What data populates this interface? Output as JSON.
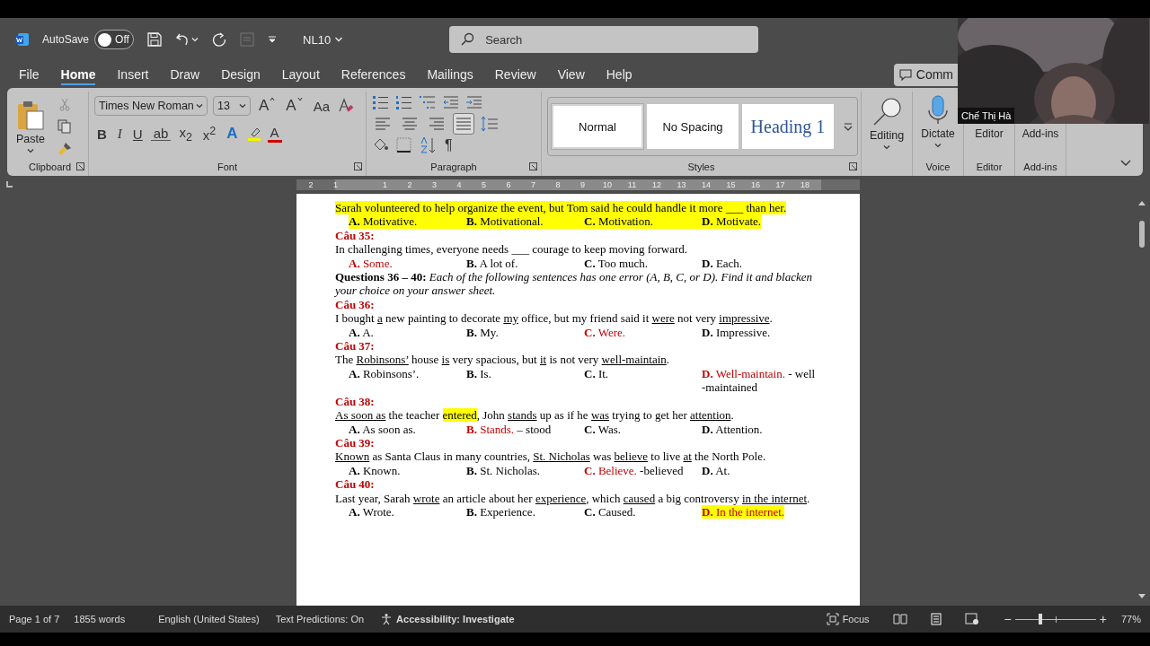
{
  "title_bar": {
    "autosave_label": "AutoSave",
    "autosave": {
      "on": false,
      "label": "Off"
    },
    "document_name": "NL10",
    "search": {
      "placeholder": "Search"
    }
  },
  "menu_tabs": [
    {
      "label": "File",
      "selected": false
    },
    {
      "label": "Home",
      "selected": true
    },
    {
      "label": "Insert",
      "selected": false
    },
    {
      "label": "Draw",
      "selected": false
    },
    {
      "label": "Design",
      "selected": false
    },
    {
      "label": "Layout",
      "selected": false
    },
    {
      "label": "References",
      "selected": false
    },
    {
      "label": "Mailings",
      "selected": false
    },
    {
      "label": "Review",
      "selected": false
    },
    {
      "label": "View",
      "selected": false
    },
    {
      "label": "Help",
      "selected": false
    }
  ],
  "comments_button": {
    "label": "Comm"
  },
  "ribbon": {
    "clipboard": {
      "paste_label": "Paste",
      "cut_disabled": true,
      "group_label": "Clipboard"
    },
    "font": {
      "font_name": "Times New Roman",
      "font_size": "13",
      "grow": "A",
      "shrink": "A",
      "change_case": "Aa",
      "format_buttons": [
        "B",
        "I",
        "U",
        "ab",
        "x$_{2}$",
        "x$^{2}$"
      ],
      "text_effects": "A",
      "font_color": "A",
      "group_label": "Font"
    },
    "paragraph": {
      "alignment": [
        {
          "kind": "left",
          "selected": false
        },
        {
          "kind": "center",
          "selected": false
        },
        {
          "kind": "right",
          "selected": false
        },
        {
          "kind": "justify",
          "selected": true
        }
      ],
      "show_marks": "¶",
      "group_label": "Paragraph"
    },
    "styles": {
      "items": [
        {
          "label": "Normal",
          "kind": "normal",
          "selected": true
        },
        {
          "label": "No Spacing",
          "kind": "normal",
          "selected": false
        },
        {
          "label": "Heading 1",
          "kind": "heading",
          "selected": false
        }
      ],
      "group_label": "Styles"
    },
    "editing": {
      "label": "Editing"
    },
    "voice": {
      "button": "Dictate",
      "group_label": "Voice"
    },
    "editor": {
      "button": "Editor",
      "group_label": "Editor"
    },
    "addins": {
      "button": "Add-ins",
      "group_label": "Add-ins"
    }
  },
  "webcam": {
    "name": "Chế Thị Hà"
  },
  "ruler": {
    "left_labels": [
      "2",
      "1"
    ],
    "right_labels": [
      "1",
      "2",
      "3",
      "4",
      "5",
      "6",
      "7",
      "8",
      "9",
      "10",
      "11",
      "12",
      "13",
      "14",
      "15",
      "16",
      "17",
      "18"
    ]
  },
  "document": [
    {
      "kind": "sentence",
      "segments": [
        {
          "text": "Sarah volunteered to help organize the event, but Tom said he could handle it more ___ than her.",
          "underlined": false,
          "highlighted": true
        }
      ]
    },
    {
      "kind": "options",
      "options": [
        {
          "letter": "A.",
          "text": "Motivative.",
          "correct": false,
          "highlighted": true
        },
        {
          "letter": "B.",
          "text": "Motivational.",
          "correct": false,
          "highlighted": true
        },
        {
          "letter": "C.",
          "text": "Motivation.",
          "correct": false,
          "highlighted": true
        },
        {
          "letter": "D.",
          "text": "Motivate.",
          "correct": false,
          "highlighted": true
        }
      ]
    },
    {
      "kind": "header",
      "text": "Câu 35:"
    },
    {
      "kind": "sentence",
      "highlighted": false,
      "segments": [
        {
          "text": "In challenging times, everyone needs ___ courage to keep moving forward.",
          "underlined": false,
          "highlighted": false
        }
      ]
    },
    {
      "kind": "options",
      "highlighted": false,
      "options": [
        {
          "letter": "A.",
          "text": "Some.",
          "correct": true,
          "highlighted": false
        },
        {
          "letter": "B.",
          "text": "A lot of.",
          "correct": false,
          "highlighted": false
        },
        {
          "letter": "C.",
          "text": "Too much.",
          "correct": false,
          "highlighted": false
        },
        {
          "letter": "D.",
          "text": "Each.",
          "correct": false,
          "highlighted": false
        }
      ]
    },
    {
      "kind": "instruction",
      "text": "**Questions 36 – 40:** *Each of the following sentences has one error (A, B, C, or D). Find it and blacken your choice on your answer sheet.*"
    },
    {
      "kind": "header",
      "text": "Câu 36:"
    },
    {
      "kind": "sentence",
      "highlighted": false,
      "segments": [
        {
          "text": "I bought ",
          "underlined": false,
          "highlighted": false
        },
        {
          "text": "a",
          "underlined": true,
          "highlighted": false
        },
        {
          "text": " new painting to decorate ",
          "underlined": false,
          "highlighted": false
        },
        {
          "text": "my",
          "underlined": true,
          "highlighted": false
        },
        {
          "text": " office, but my friend said it ",
          "underlined": false,
          "highlighted": false
        },
        {
          "text": "were",
          "underlined": true,
          "highlighted": false
        },
        {
          "text": " not very ",
          "underlined": false,
          "highlighted": false
        },
        {
          "text": "impressive",
          "underlined": true,
          "highlighted": false
        },
        {
          "text": ".",
          "underlined": false,
          "highlighted": false
        }
      ]
    },
    {
      "kind": "options",
      "highlighted": false,
      "options": [
        {
          "letter": "A.",
          "text": "A.",
          "correct": false,
          "highlighted": false
        },
        {
          "letter": "B.",
          "text": "My.",
          "correct": false,
          "highlighted": false
        },
        {
          "letter": "C.",
          "text": "Were.",
          "correct": true,
          "highlighted": false
        },
        {
          "letter": "D.",
          "text": "Impressive.",
          "correct": false,
          "highlighted": false
        }
      ]
    },
    {
      "kind": "header",
      "text": "Câu 37:"
    },
    {
      "kind": "sentence",
      "highlighted": false,
      "segments": [
        {
          "text": "The ",
          "underlined": false,
          "highlighted": false
        },
        {
          "text": "Robinsons’",
          "underlined": true,
          "highlighted": false
        },
        {
          "text": " house ",
          "underlined": false,
          "highlighted": false
        },
        {
          "text": "is",
          "underlined": true,
          "highlighted": false
        },
        {
          "text": " very spacious, but ",
          "underlined": false,
          "highlighted": false
        },
        {
          "text": "it",
          "underlined": true,
          "highlighted": false
        },
        {
          "text": " is not very ",
          "underlined": false,
          "highlighted": false
        },
        {
          "text": "well-maintain",
          "underlined": true,
          "highlighted": false
        },
        {
          "text": ".",
          "underlined": false,
          "highlighted": false
        }
      ]
    },
    {
      "kind": "options",
      "highlighted": false,
      "options": [
        {
          "letter": "A.",
          "text": "Robinsons’.",
          "correct": false,
          "highlighted": false
        },
        {
          "letter": "B.",
          "text": "Is.",
          "correct": false,
          "highlighted": false
        },
        {
          "letter": "C.",
          "text": "It.",
          "correct": false,
          "highlighted": false
        },
        {
          "letter": "D.",
          "text": "Well-maintain.",
          "correct": true,
          "highlighted": false,
          "note": "- well -maintained"
        }
      ]
    },
    {
      "kind": "header",
      "text": "Câu 38:"
    },
    {
      "kind": "sentence",
      "highlighted": false,
      "segments": [
        {
          "text": "As soon as",
          "underlined": true,
          "highlighted": false
        },
        {
          "text": " the teacher ",
          "underlined": false,
          "highlighted": false
        },
        {
          "text": "entered",
          "underlined": false,
          "highlighted": true
        },
        {
          "text": ", John ",
          "underlined": false,
          "highlighted": false
        },
        {
          "text": "stands",
          "underlined": true,
          "highlighted": false
        },
        {
          "text": " up as if he ",
          "underlined": false,
          "highlighted": false
        },
        {
          "text": "was",
          "underlined": true,
          "highlighted": false
        },
        {
          "text": " trying to get her ",
          "underlined": false,
          "highlighted": false
        },
        {
          "text": "attention",
          "underlined": true,
          "highlighted": false
        },
        {
          "text": ".",
          "underlined": false,
          "highlighted": false
        }
      ]
    },
    {
      "kind": "options",
      "highlighted": false,
      "options": [
        {
          "letter": "A.",
          "text": "As soon as.",
          "correct": false,
          "highlighted": false
        },
        {
          "letter": "B.",
          "text": "Stands.",
          "correct": true,
          "highlighted": false,
          "note": "– stood"
        },
        {
          "letter": "C.",
          "text": "Was.",
          "correct": false,
          "highlighted": false
        },
        {
          "letter": "D.",
          "text": "Attention.",
          "correct": false,
          "highlighted": false
        }
      ]
    },
    {
      "kind": "header",
      "text": "Câu 39:"
    },
    {
      "kind": "sentence",
      "highlighted": false,
      "segments": [
        {
          "text": "Known",
          "underlined": true,
          "highlighted": false
        },
        {
          "text": " as Santa Claus in many countries, ",
          "underlined": false,
          "highlighted": false
        },
        {
          "text": "St. Nicholas",
          "underlined": true,
          "highlighted": false
        },
        {
          "text": " was ",
          "underlined": false,
          "highlighted": false
        },
        {
          "text": "believe",
          "underlined": true,
          "highlighted": false
        },
        {
          "text": " to live ",
          "underlined": false,
          "highlighted": false
        },
        {
          "text": "at",
          "underlined": true,
          "highlighted": false
        },
        {
          "text": " the North Pole.",
          "underlined": false,
          "highlighted": false
        }
      ]
    },
    {
      "kind": "options",
      "highlighted": false,
      "options": [
        {
          "letter": "A.",
          "text": "Known.",
          "correct": false,
          "highlighted": false
        },
        {
          "letter": "B.",
          "text": "St. Nicholas.",
          "correct": false,
          "highlighted": false
        },
        {
          "letter": "C.",
          "text": "Believe.",
          "correct": true,
          "highlighted": false,
          "note": "-believed"
        },
        {
          "letter": "D.",
          "text": "At.",
          "correct": false,
          "highlighted": false
        }
      ]
    },
    {
      "kind": "header",
      "text": "Câu 40:"
    },
    {
      "kind": "sentence",
      "highlighted": false,
      "segments": [
        {
          "text": "Last year, Sarah ",
          "underlined": false,
          "highlighted": false
        },
        {
          "text": "wrote",
          "underlined": true,
          "highlighted": false
        },
        {
          "text": " an article about her ",
          "underlined": false,
          "highlighted": false
        },
        {
          "text": "experience",
          "underlined": true,
          "highlighted": false
        },
        {
          "text": ", which ",
          "underlined": false,
          "highlighted": false
        },
        {
          "text": "caused",
          "underlined": true,
          "highlighted": false
        },
        {
          "text": " a big controversy ",
          "underlined": false,
          "highlighted": false
        },
        {
          "text": "in the internet",
          "underlined": true,
          "highlighted": false
        },
        {
          "text": ".",
          "underlined": false,
          "highlighted": false
        }
      ]
    },
    {
      "kind": "options",
      "highlighted": false,
      "options": [
        {
          "letter": "A.",
          "text": "Wrote.",
          "correct": false,
          "highlighted": false
        },
        {
          "letter": "B.",
          "text": "Experience.",
          "correct": false,
          "highlighted": false
        },
        {
          "letter": "C.",
          "text": "Caused.",
          "correct": false,
          "highlighted": false
        },
        {
          "letter": "D.",
          "text": "In the internet.",
          "correct": true,
          "highlighted": true
        }
      ]
    }
  ],
  "status_bar": {
    "page": "Page 1 of 7",
    "words": "1855 words",
    "language": "English (United States)",
    "predictions": "Text Predictions: On",
    "accessibility": "Accessibility: Investigate",
    "focus": "Focus",
    "zoom_out": "−",
    "zoom_in": "+",
    "zoom": {
      "level": 0.31,
      "label": "77%"
    }
  }
}
